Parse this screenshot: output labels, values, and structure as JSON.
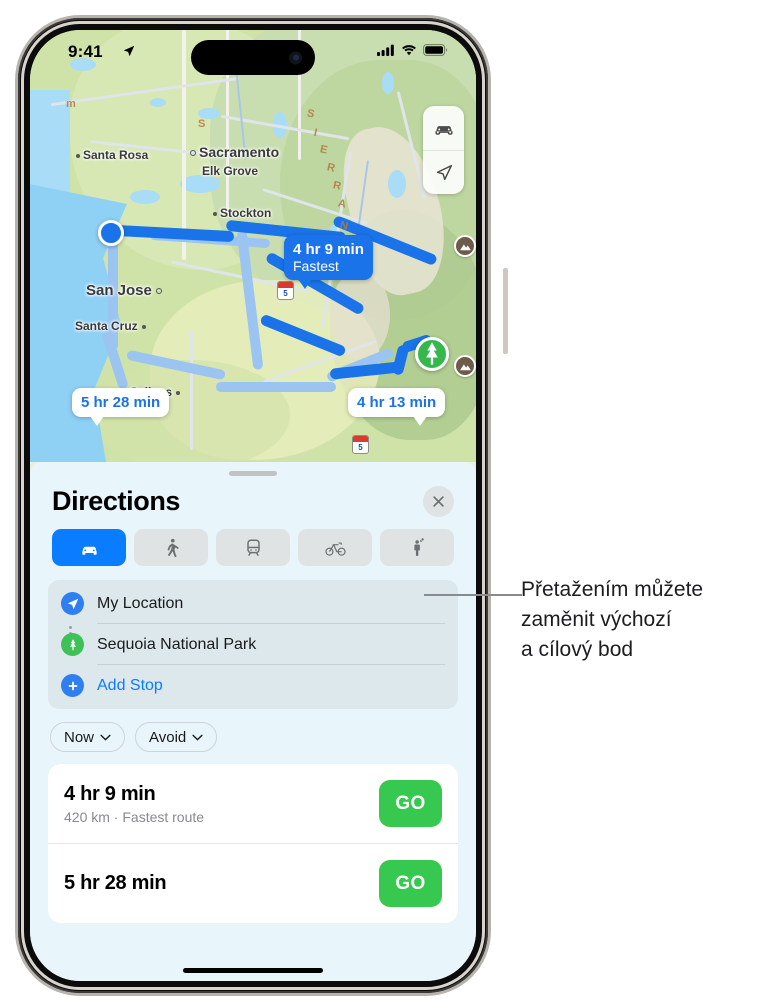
{
  "status_bar": {
    "time": "9:41",
    "location_icon": "location-arrow-icon",
    "signal_icon": "cellular-signal-icon",
    "wifi_icon": "wifi-icon",
    "battery_icon": "battery-full-icon"
  },
  "map": {
    "cities": [
      {
        "name": "Santa Rosa",
        "marker": "dot"
      },
      {
        "name": "Sacramento",
        "marker": "ring"
      },
      {
        "name": "Elk Grove",
        "marker": "dot"
      },
      {
        "name": "Stockton",
        "marker": "dot"
      },
      {
        "name": "San Jose",
        "marker": "ring"
      },
      {
        "name": "Santa Cruz",
        "marker": "dot"
      },
      {
        "name": "Salinas",
        "marker": "dot"
      }
    ],
    "range_letters": [
      "S",
      "I",
      "E",
      "R",
      "R",
      "A",
      "N",
      "E",
      "V"
    ],
    "highway_shields": [
      "5",
      "5"
    ],
    "callouts": [
      {
        "time": "4 hr 9 min",
        "note": "Fastest",
        "style": "selected"
      },
      {
        "time": "5 hr 28 min",
        "note": "",
        "style": "alternate"
      },
      {
        "time": "4 hr 13 min",
        "note": "",
        "style": "alternate"
      }
    ],
    "controls": [
      {
        "name": "driving-mode-button",
        "icon": "car-icon"
      },
      {
        "name": "recenter-location-button",
        "icon": "location-arrow-icon"
      }
    ],
    "origin_marker": "current-location-dot",
    "destination_marker": "tree-pin-icon"
  },
  "sheet": {
    "title": "Directions",
    "close_label": "×",
    "modes": [
      {
        "id": "drive",
        "icon": "car-icon",
        "selected": true
      },
      {
        "id": "walk",
        "icon": "walk-icon",
        "selected": false
      },
      {
        "id": "transit",
        "icon": "train-icon",
        "selected": false
      },
      {
        "id": "cycle",
        "icon": "bicycle-icon",
        "selected": false
      },
      {
        "id": "ride",
        "icon": "rideshare-icon",
        "selected": false
      }
    ],
    "route_fields": [
      {
        "label": "My Location",
        "icon": "location-arrow-icon",
        "icon_color": "#2f7ff0",
        "link": false
      },
      {
        "label": "Sequoia National Park",
        "icon": "tree-icon",
        "icon_color": "#3cc257",
        "link": false
      },
      {
        "label": "Add Stop",
        "icon": "plus-icon",
        "icon_color": "#2f7ff0",
        "link": true
      }
    ],
    "filters": [
      {
        "label": "Now",
        "icon": "chevron-down-icon"
      },
      {
        "label": "Avoid",
        "icon": "chevron-down-icon"
      }
    ],
    "routes": [
      {
        "duration": "4 hr 9 min",
        "detail": "420 km · Fastest route",
        "go_label": "GO"
      },
      {
        "duration": "5 hr 28 min",
        "detail": "",
        "go_label": "GO"
      }
    ]
  },
  "annotation": {
    "line1": "Přetažením můžete",
    "line2": "zaměnit výchozí",
    "line3": "a cílový bod"
  },
  "colors": {
    "accent_blue": "#0a7cff",
    "route_blue": "#1a73e8",
    "go_green": "#37c94f",
    "pin_green": "#34b84c"
  }
}
